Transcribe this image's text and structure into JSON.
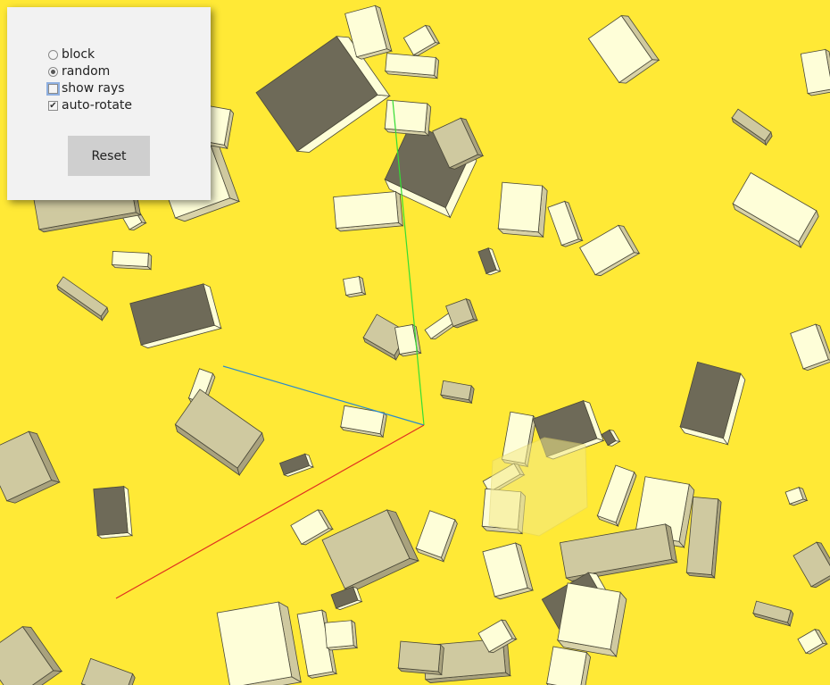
{
  "controls": {
    "block_label": "block",
    "random_label": "random",
    "show_rays_label": "show rays",
    "auto_rotate_label": "auto-rotate",
    "reset_label": "Reset",
    "selected_mode": "random",
    "show_rays": false,
    "auto_rotate": true
  },
  "scene": {
    "background_color": "#ffe936",
    "block_face_light": "#fefed8",
    "block_face_mid": "#cfc9a0",
    "block_face_dark": "#6e6a58",
    "ray_colors": [
      "#33dd33",
      "#2a8acc",
      "#e03020"
    ]
  }
}
